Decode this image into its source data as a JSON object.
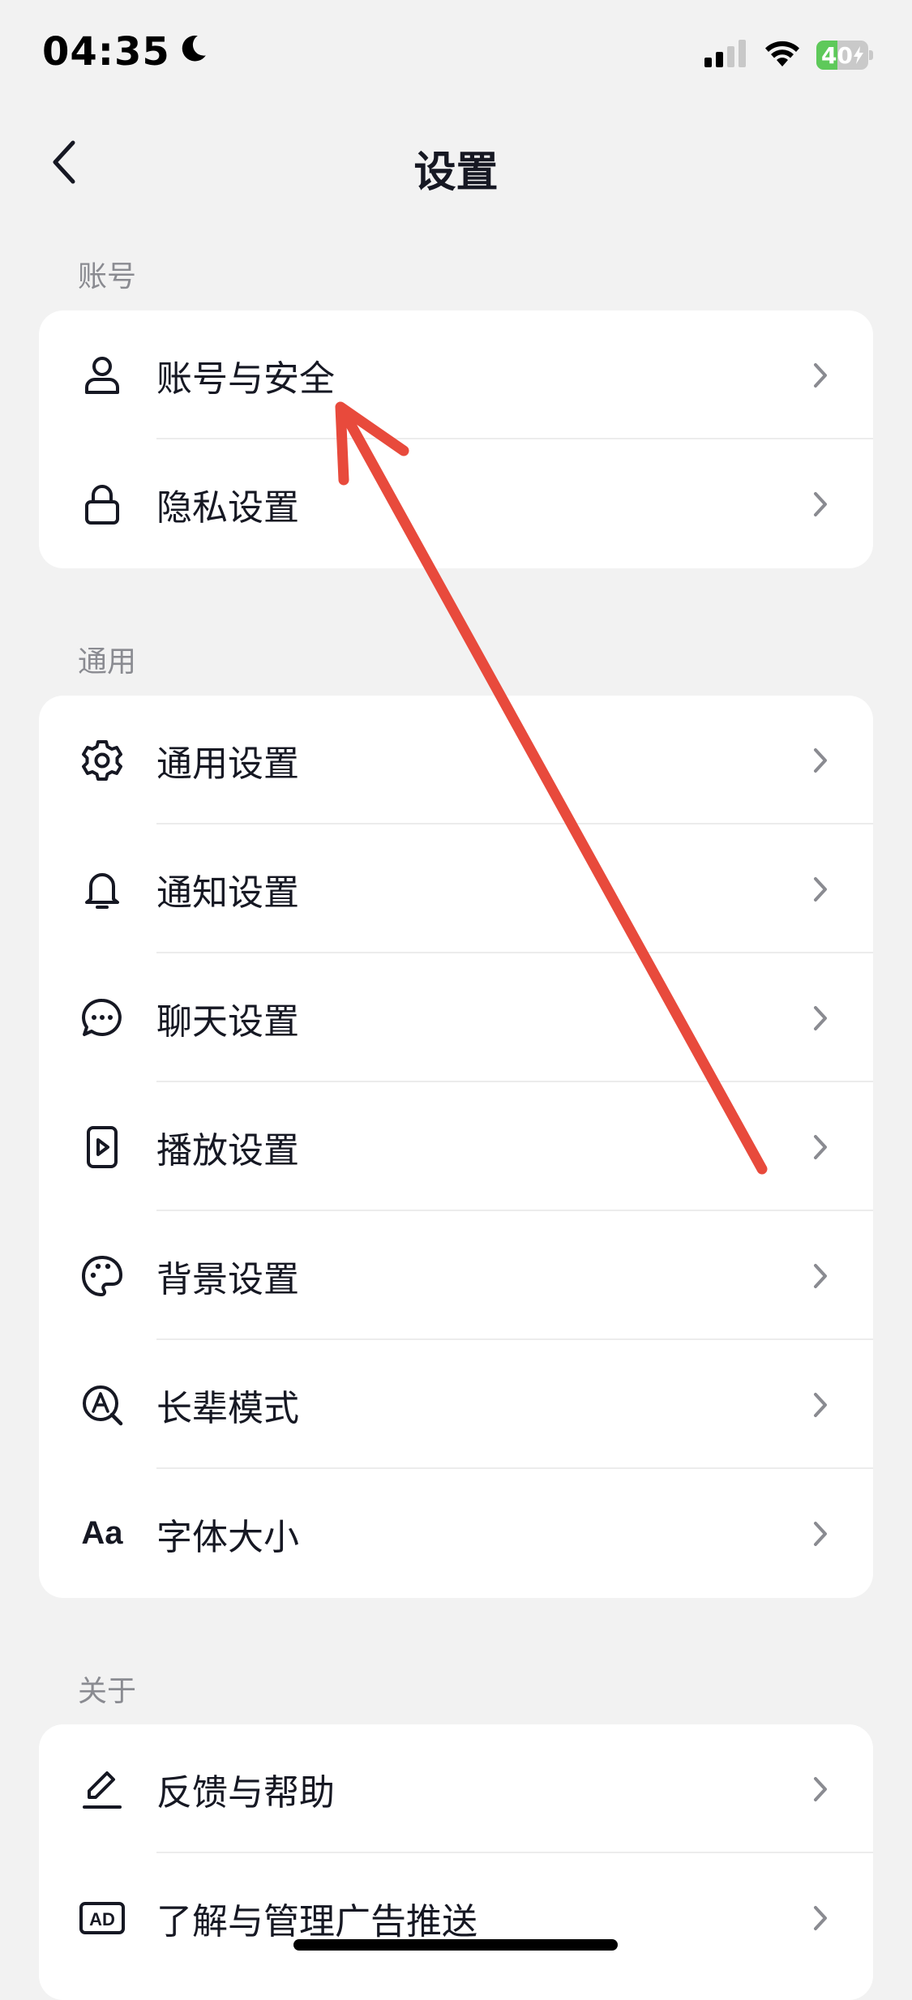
{
  "status_bar": {
    "time": "04:35",
    "battery_text": "40",
    "battery_level_percent": 40,
    "icons": [
      "moon-icon",
      "cellular-signal-icon",
      "wifi-icon",
      "battery-charging-icon"
    ]
  },
  "nav": {
    "title": "设置",
    "back_icon": "chevron-left-icon"
  },
  "sections": {
    "account": {
      "label": "账号",
      "items": [
        {
          "label": "账号与安全",
          "icon": "user-icon"
        },
        {
          "label": "隐私设置",
          "icon": "lock-icon"
        }
      ]
    },
    "general": {
      "label": "通用",
      "items": [
        {
          "label": "通用设置",
          "icon": "gear-icon"
        },
        {
          "label": "通知设置",
          "icon": "bell-icon"
        },
        {
          "label": "聊天设置",
          "icon": "chat-bubble-icon"
        },
        {
          "label": "播放设置",
          "icon": "play-icon"
        },
        {
          "label": "背景设置",
          "icon": "palette-icon"
        },
        {
          "label": "长辈模式",
          "icon": "elder-mode-icon"
        },
        {
          "label": "字体大小",
          "icon": "font-size-icon",
          "icon_text": "Aa"
        }
      ]
    },
    "about": {
      "label": "关于",
      "items": [
        {
          "label": "反馈与帮助",
          "icon": "pencil-icon"
        },
        {
          "label": "了解与管理广告推送",
          "icon": "ad-icon",
          "icon_text": "AD"
        }
      ]
    }
  },
  "colors": {
    "background": "#f2f2f2",
    "card": "#ffffff",
    "text_primary": "#161823",
    "text_secondary": "#8a8b91",
    "chevron": "#8a8b91",
    "annotation_arrow": "#e84a3c",
    "battery_fill": "#5ec95a"
  }
}
